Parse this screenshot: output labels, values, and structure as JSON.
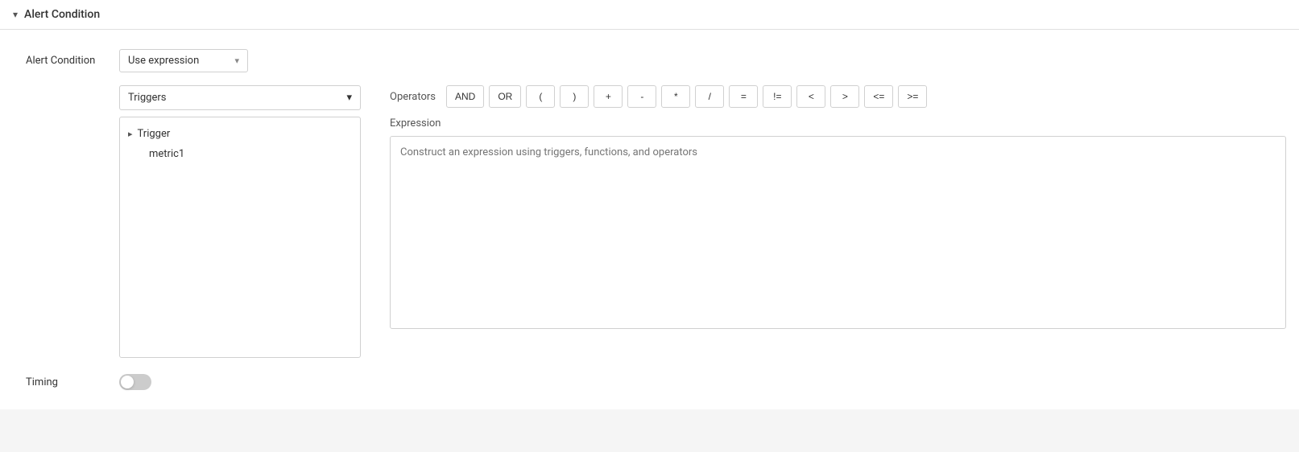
{
  "header": {
    "chevron": "▾",
    "title": "Alert Condition"
  },
  "form": {
    "alert_condition_label": "Alert Condition",
    "condition_dropdown": {
      "value": "Use expression",
      "chevron": "▾"
    },
    "triggers_dropdown": {
      "value": "Triggers",
      "chevron": "▾"
    }
  },
  "tree": {
    "root": {
      "arrow": "▸",
      "label": "Trigger"
    },
    "children": [
      {
        "label": "metric1"
      }
    ]
  },
  "operators": {
    "label": "Operators",
    "buttons": [
      "AND",
      "OR",
      "(",
      ")",
      "+",
      "-",
      "*",
      "/",
      "=",
      "!=",
      "<",
      ">",
      "<=",
      ">="
    ]
  },
  "expression": {
    "label": "Expression",
    "placeholder": "Construct an expression using triggers, functions, and operators"
  },
  "timing": {
    "label": "Timing",
    "toggle_active": false
  }
}
